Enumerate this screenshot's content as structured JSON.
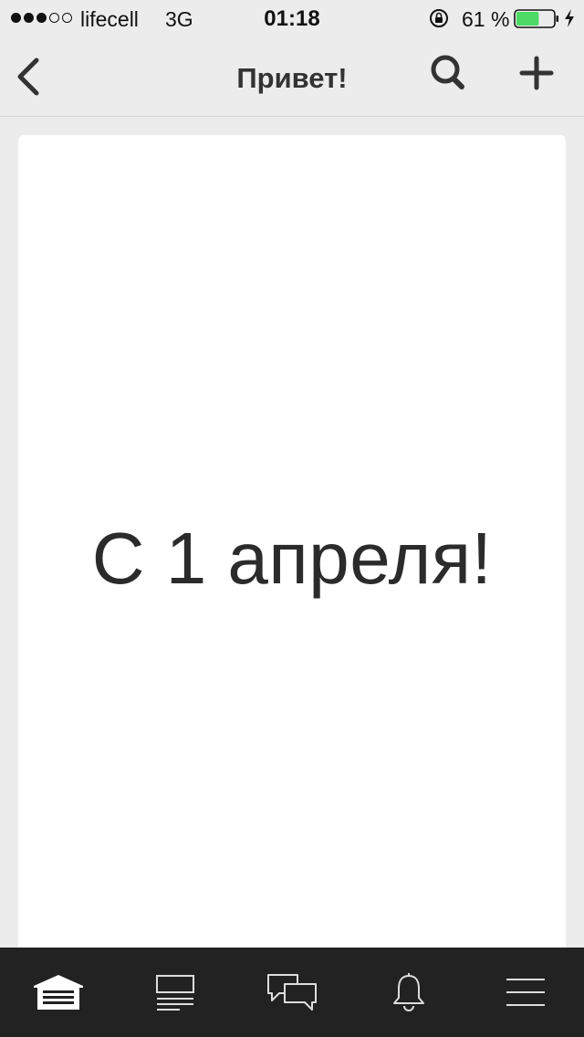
{
  "status_bar": {
    "signal_filled": 3,
    "signal_total": 5,
    "carrier": "lifecell",
    "network": "3G",
    "time": "01:18",
    "battery_percent": "61 %",
    "battery_level": 0.61,
    "battery_color": "#4cd964"
  },
  "nav_bar": {
    "title": "Привет!",
    "back_icon": "chevron-left-icon",
    "search_icon": "search-icon",
    "add_icon": "plus-icon"
  },
  "card": {
    "text": "С 1 апреля!"
  },
  "tab_bar": {
    "tabs": [
      {
        "icon": "garage-icon",
        "selected": true
      },
      {
        "icon": "feed-icon",
        "selected": false
      },
      {
        "icon": "messages-icon",
        "selected": false
      },
      {
        "icon": "bell-icon",
        "selected": false
      },
      {
        "icon": "menu-icon",
        "selected": false
      }
    ]
  },
  "colors": {
    "background": "#ececec",
    "card": "#ffffff",
    "tab_bar": "#222222",
    "text": "#2b2b2b"
  }
}
